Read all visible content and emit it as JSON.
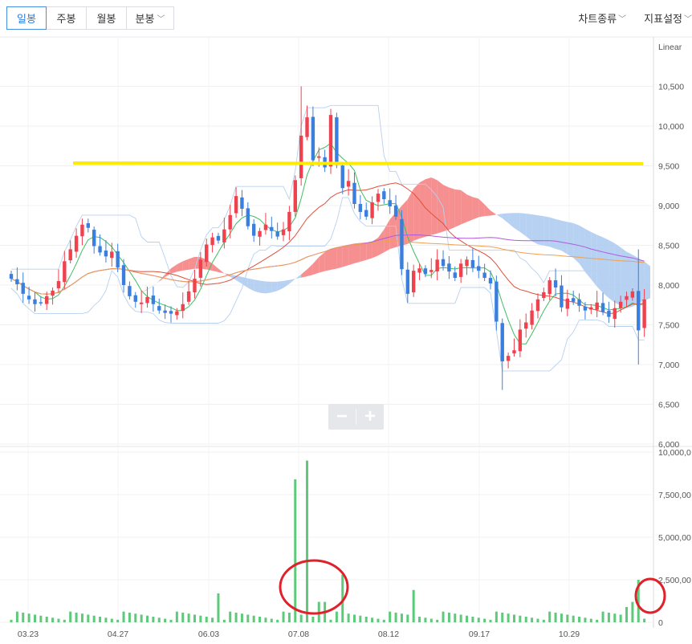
{
  "period_tabs": [
    {
      "label": "일봉",
      "active": true
    },
    {
      "label": "주봉",
      "active": false
    },
    {
      "label": "월봉",
      "active": false
    },
    {
      "label": "분봉",
      "active": false,
      "dropdown": true
    }
  ],
  "right_menu": {
    "chart_type": "차트종류",
    "indicator_settings": "지표설정"
  },
  "zoom": {
    "minus": "−",
    "plus": "+"
  },
  "colors": {
    "up": "#f0414f",
    "down": "#3a7fdd",
    "volume": "#5ec97a",
    "line_short": "#3fbf5f",
    "line_mid": "#e0503c",
    "line_long": "#b159e0",
    "line_120": "#f0a050",
    "cloud_up": "#f57b7b",
    "cloud_down": "#a9c9f0",
    "annotation_line": "#ffeb00",
    "annotation_circle": "#e0202a"
  },
  "chart_data": [
    {
      "type": "candlestick",
      "scale": "Linear",
      "ylim": [
        6000,
        11000
      ],
      "y_ticks": [
        "6,000",
        "6,500",
        "7,000",
        "7,500",
        "8,000",
        "8,500",
        "9,000",
        "9,500",
        "10,000",
        "10,500"
      ],
      "x_ticks": [
        "03.23",
        "04.27",
        "06.03",
        "07.08",
        "08.12",
        "09.17",
        "10.29"
      ],
      "approx_close": [
        8080,
        8010,
        7890,
        7820,
        7760,
        7780,
        7860,
        7930,
        8050,
        8300,
        8450,
        8620,
        8760,
        8720,
        8490,
        8410,
        8360,
        8420,
        8220,
        8000,
        7860,
        7790,
        7780,
        7850,
        7760,
        7680,
        7650,
        7640,
        7670,
        7760,
        7920,
        8080,
        8320,
        8510,
        8600,
        8560,
        8700,
        8880,
        9120,
        8960,
        8740,
        8620,
        8680,
        8760,
        8680,
        8610,
        8700,
        8920,
        9320,
        9880,
        10110,
        9570,
        9620,
        9480,
        10140,
        9510,
        9220,
        9310,
        9020,
        8920,
        8860,
        9040,
        9150,
        9080,
        8990,
        8860,
        8200,
        7890,
        8180,
        8210,
        8140,
        8190,
        8320,
        8240,
        8170,
        8090,
        8270,
        8320,
        8220,
        8180,
        8090,
        8020,
        7540,
        7040,
        7110,
        7180,
        7440,
        7530,
        7680,
        7820,
        7910,
        8060,
        7970,
        7720,
        7830,
        7790,
        7740,
        7680,
        7720,
        7780,
        7660,
        7600,
        7710,
        7790,
        7860,
        7920,
        7430,
        7820
      ]
    },
    {
      "type": "bar",
      "series_name": "volume",
      "ylim": [
        0,
        10000000
      ],
      "y_ticks": [
        "0",
        "2,500,00",
        "5,000,00",
        "7,500,00",
        "10,000,0"
      ],
      "notable_values": [
        8400000,
        9500000,
        2800000,
        1200000
      ]
    }
  ]
}
